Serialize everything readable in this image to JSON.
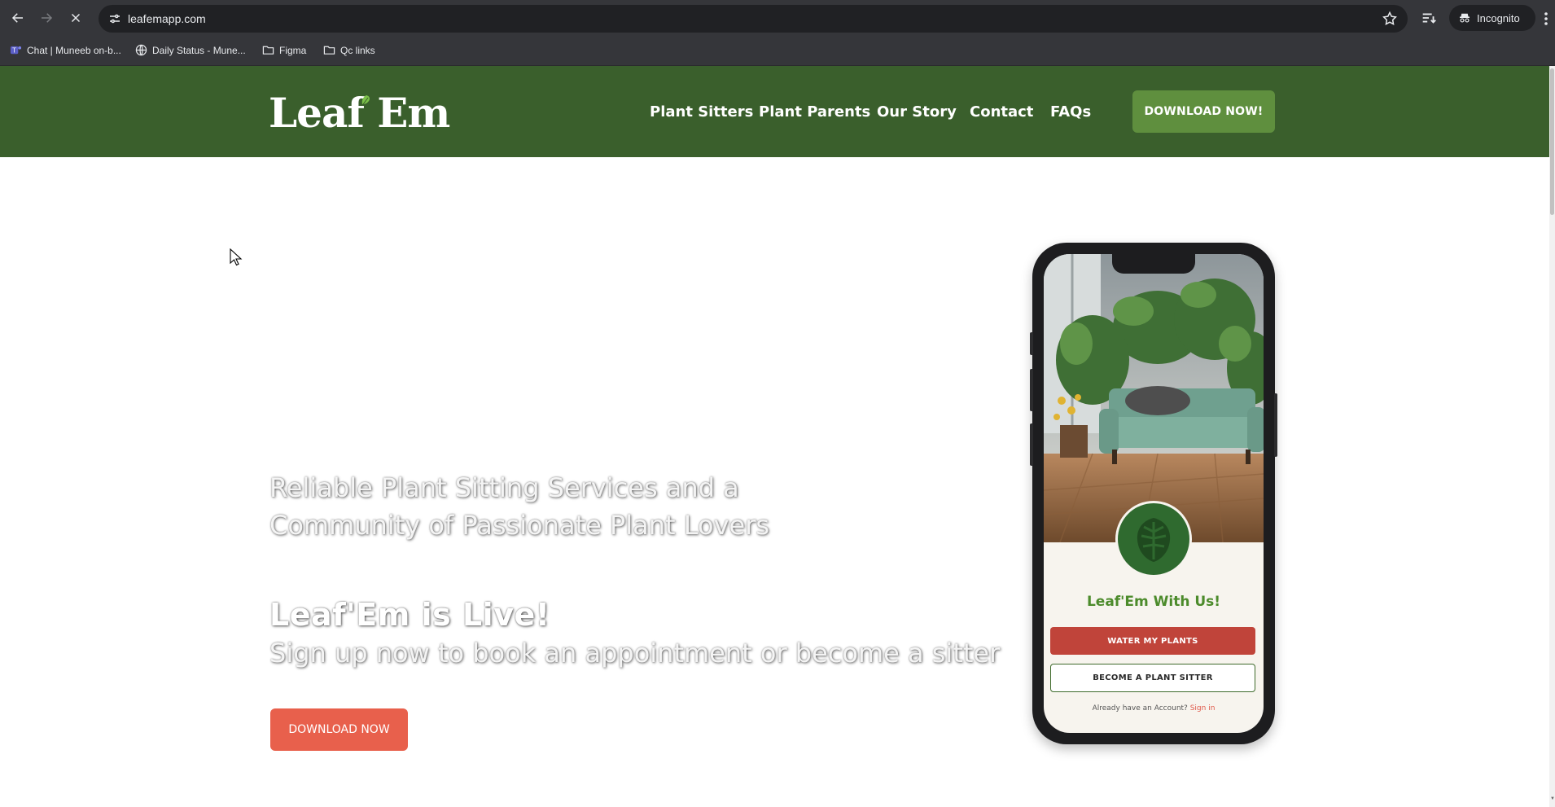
{
  "browser": {
    "url": "leafemapp.com",
    "profile_label": "Incognito",
    "icons": {
      "back": "back-arrow-icon",
      "forward": "forward-arrow-icon",
      "stop": "close-icon",
      "site_info": "tune-icon",
      "bookmark": "star-icon",
      "tab_search": "tab-search-icon",
      "incognito": "incognito-icon",
      "menu": "kebab-menu-icon"
    },
    "bookmarks": [
      {
        "label": "Chat | Muneeb on-b...",
        "icon": "teams-icon"
      },
      {
        "label": "Daily Status - Mune...",
        "icon": "globe-icon"
      },
      {
        "label": "Figma",
        "icon": "folder-icon"
      },
      {
        "label": "Qc links",
        "icon": "folder-icon"
      }
    ]
  },
  "site": {
    "logo_text": "Leaf Em",
    "nav": [
      "Plant Sitters",
      "Plant Parents",
      "Our Story",
      "Contact",
      "FAQs"
    ],
    "header_cta": "DOWNLOAD NOW!",
    "colors": {
      "header_bg": "#3a5f2c",
      "header_cta": "#5f8f3e",
      "hero_cta": "#e8604c",
      "brand_green": "#4c8b2b"
    }
  },
  "hero": {
    "tagline_line1": "Reliable Plant Sitting Services and a",
    "tagline_line2": "Community of Passionate Plant Lovers",
    "live_heading": "Leaf'Em is Live!",
    "subheading": "Sign up now to book an appointment or become a sitter",
    "cta": "DOWNLOAD NOW"
  },
  "phone_app": {
    "title": "Leaf'Em With Us!",
    "primary_button": "WATER MY PLANTS",
    "secondary_button": "BECOME A PLANT SITTER",
    "signin_prompt": "Already have an Account?",
    "signin_link": "Sign in"
  }
}
